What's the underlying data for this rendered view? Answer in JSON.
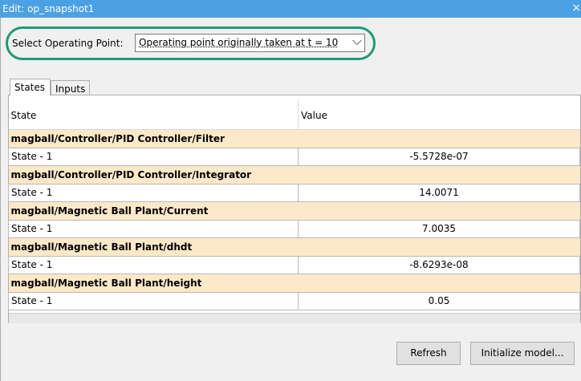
{
  "window": {
    "title": "Edit: op_snapshot1",
    "close_glyph": "×"
  },
  "operating_point": {
    "label": "Select Operating Point:",
    "selected": "Operating point originally taken at t = 10",
    "highlight_color": "#1d9a78"
  },
  "tabs": [
    {
      "label": "States",
      "active": true
    },
    {
      "label": "Inputs",
      "active": false
    }
  ],
  "table": {
    "columns": [
      "State",
      "Value"
    ],
    "groups": [
      {
        "name": "magball/Controller/PID Controller/Filter",
        "rows": [
          {
            "state": "State - 1",
            "value": "-5.5728e-07"
          }
        ]
      },
      {
        "name": "magball/Controller/PID Controller/Integrator",
        "rows": [
          {
            "state": "State - 1",
            "value": "14.0071"
          }
        ]
      },
      {
        "name": "magball/Magnetic Ball Plant/Current",
        "rows": [
          {
            "state": "State - 1",
            "value": "7.0035"
          }
        ]
      },
      {
        "name": "magball/Magnetic Ball Plant/dhdt",
        "rows": [
          {
            "state": "State - 1",
            "value": "-8.6293e-08"
          }
        ]
      },
      {
        "name": "magball/Magnetic Ball Plant/height",
        "rows": [
          {
            "state": "State - 1",
            "value": "0.05"
          }
        ]
      }
    ]
  },
  "buttons": {
    "refresh": "Refresh",
    "initialize": "Initialize model..."
  },
  "colors": {
    "titlebar": "#4ca0e4",
    "group_row": "#fde9c8"
  }
}
